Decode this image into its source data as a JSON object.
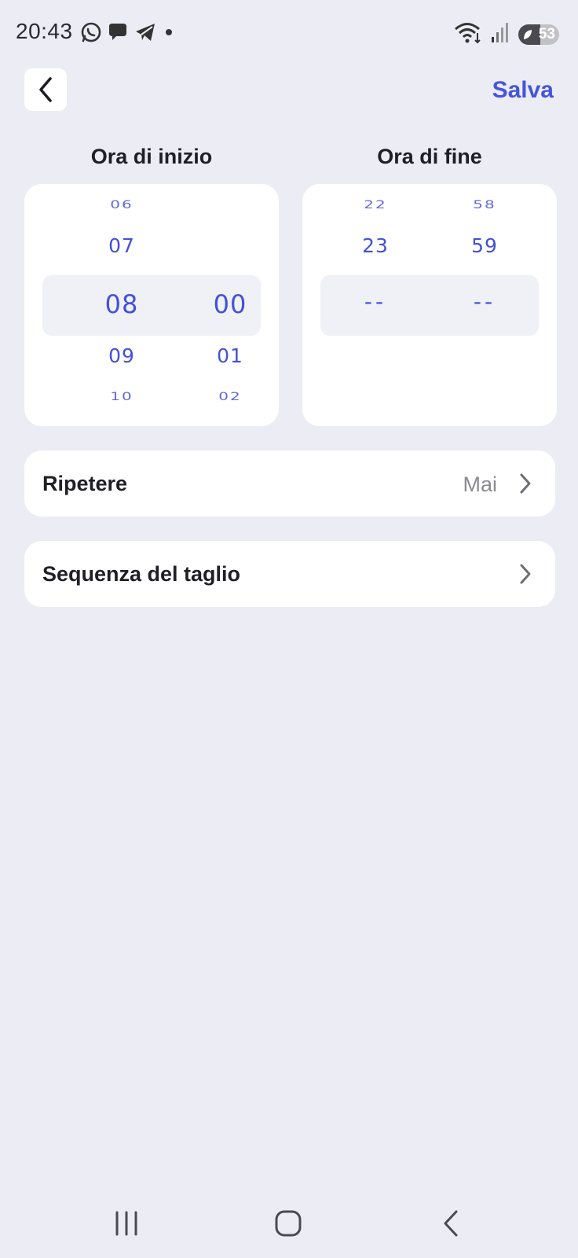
{
  "status_bar": {
    "time": "20:43",
    "battery_level": "53",
    "battery_percent": 53,
    "notification_icons": [
      "whatsapp-icon",
      "chat-bubble-icon",
      "telegram-icon",
      "dot-icon"
    ],
    "system_icons": [
      "wifi-icon",
      "signal-icon",
      "battery-icon"
    ]
  },
  "header": {
    "back_icon": "chevron-left-icon",
    "save_label": "Salva"
  },
  "start_time": {
    "title": "Ora di inizio",
    "hours": {
      "above2": "06",
      "above1": "07",
      "selected": "08",
      "below1": "09",
      "below2": "10"
    },
    "minutes": {
      "above2": "",
      "above1": "",
      "selected": "00",
      "below1": "01",
      "below2": "02"
    }
  },
  "end_time": {
    "title": "Ora di fine",
    "hours": {
      "above2": "22",
      "above1": "23",
      "selected": "--"
    },
    "minutes": {
      "above2": "58",
      "above1": "59",
      "selected": "--"
    }
  },
  "settings": {
    "repeat": {
      "label": "Ripetere",
      "value": "Mai"
    },
    "cut_sequence": {
      "label": "Sequenza del taglio"
    }
  },
  "colors": {
    "accent": "#4654dc",
    "picker_text": "#4350d8",
    "background": "#ecedf4",
    "card": "#ffffff",
    "highlight": "#eff1f6"
  }
}
